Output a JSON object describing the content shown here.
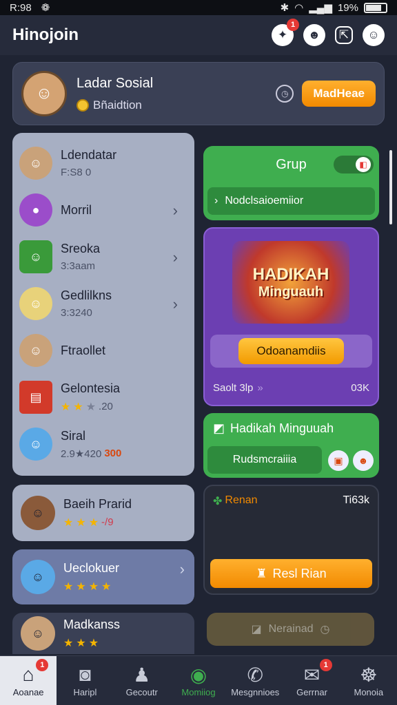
{
  "status_bar": {
    "time": "R:98",
    "battery": "19%"
  },
  "header": {
    "title": "Hinojoin",
    "badge_count": "1"
  },
  "profile": {
    "name": "Ladar Sosial",
    "subtitle": "Bñaidtion",
    "action_label": "MadHeae"
  },
  "list": {
    "items": [
      {
        "name": "Ldendatar",
        "sub": "F:S8 0"
      },
      {
        "name": "Morril",
        "sub": ""
      },
      {
        "name": "Sreoka",
        "sub": "3:3aam"
      },
      {
        "name": "Gedlilkns",
        "sub": "3:3240"
      },
      {
        "name": "Ftraollet",
        "sub": ""
      },
      {
        "name": "Gelontesia",
        "sub": ".20"
      },
      {
        "name": "Siral",
        "sub": "2.9★420",
        "badge": "300"
      }
    ]
  },
  "cards": [
    {
      "name": "Baeih Prarid",
      "badge": "-/9"
    },
    {
      "name": "Ueclokuer"
    },
    {
      "name": "Madkanss"
    }
  ],
  "grup": {
    "title": "Grup",
    "bar_label": "Nodclsaioemiior"
  },
  "promo": {
    "line1": "HADIKAH",
    "line2": "Minguauh",
    "button_label": "Odoanamdiis",
    "footer_left": "Saolt 3lp",
    "footer_right": "03K"
  },
  "weekly": {
    "title": "Hadikah Minguuah",
    "bar_label": "Rudsmcraiiia"
  },
  "reward": {
    "title": "Renan",
    "count": "Ti63k",
    "button_label": "Resl Rian"
  },
  "dim_card": {
    "label": "Nerainad"
  },
  "nav": [
    {
      "label": "Aoanae",
      "icon": "home-icon",
      "badge": "1"
    },
    {
      "label": "Haripl",
      "icon": "camera-icon"
    },
    {
      "label": "Gecoutr",
      "icon": "person-icon"
    },
    {
      "label": "Momiiog",
      "icon": "chat-icon"
    },
    {
      "label": "Mesgnnioes",
      "icon": "phone-icon"
    },
    {
      "label": "Gerrnar",
      "icon": "mail-icon",
      "badge": "1"
    },
    {
      "label": "Monoia",
      "icon": "group-icon"
    }
  ],
  "colors": {
    "accent_green": "#3fae4f",
    "accent_orange": "#f28a00",
    "accent_purple": "#6c3fb2"
  }
}
